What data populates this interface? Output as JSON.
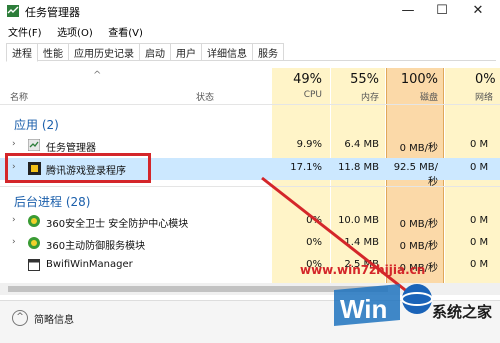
{
  "window": {
    "title": "任务管理器",
    "controls": {
      "minimize": "—",
      "maximize": "☐",
      "close": "✕"
    }
  },
  "menu": [
    "文件(F)",
    "选项(O)",
    "查看(V)"
  ],
  "tabs": [
    "进程",
    "性能",
    "应用历史记录",
    "启动",
    "用户",
    "详细信息",
    "服务"
  ],
  "columns": {
    "name": "名称",
    "status": "状态",
    "cpu": {
      "pct": "49%",
      "label": "CPU"
    },
    "mem": {
      "pct": "55%",
      "label": "内存"
    },
    "disk": {
      "pct": "100%",
      "label": "磁盘"
    },
    "net": {
      "pct": "0%",
      "label": "网络"
    }
  },
  "groups": {
    "apps": "应用 (2)",
    "background": "后台进程 (28)"
  },
  "rows": [
    {
      "name": "任务管理器",
      "cpu": "9.9%",
      "mem": "6.4 MB",
      "disk": "0 MB/秒",
      "net": "0 M"
    },
    {
      "name": "腾讯游戏登录程序",
      "cpu": "17.1%",
      "mem": "11.8 MB",
      "disk": "92.5 MB/秒",
      "net": "0 M"
    },
    {
      "name": "360安全卫士 安全防护中心模块",
      "cpu": "0%",
      "mem": "10.0 MB",
      "disk": "0 MB/秒",
      "net": "0 M"
    },
    {
      "name": "360主动防御服务模块",
      "cpu": "0%",
      "mem": "1.4 MB",
      "disk": "0 MB/秒",
      "net": "0 M"
    },
    {
      "name": "BwifiWinManager",
      "cpu": "0%",
      "mem": "2.5 MB",
      "disk": "0 MB/秒",
      "net": "0 M"
    }
  ],
  "footer": {
    "label": "简略信息"
  },
  "watermark": {
    "url": "www.win7zhijia.cn",
    "brand": "系统之家"
  },
  "colors": {
    "cpu_bg": "#fff4c8",
    "disk_bg": "#fbd9a8",
    "highlight": "#d4262a",
    "group": "#1b5fab"
  }
}
